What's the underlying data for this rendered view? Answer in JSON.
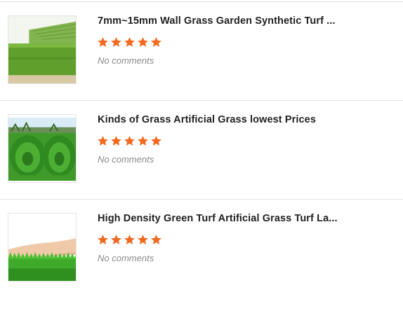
{
  "products": [
    {
      "title": "7mm~15mm Wall Grass Garden Synthetic Turf ...",
      "rating": 5,
      "comments": "No comments",
      "image": "green-wall-grass-thumbnail"
    },
    {
      "title": "Kinds of Grass Artificial Grass lowest Prices",
      "rating": 5,
      "comments": "No comments",
      "image": "rolled-artificial-grass-thumbnail"
    },
    {
      "title": "High Density Green Turf Artificial Grass Turf La...",
      "rating": 5,
      "comments": "No comments",
      "image": "hand-on-grass-thumbnail"
    }
  ],
  "colors": {
    "star": "#f26a22",
    "title": "#222222",
    "comments": "#8a8a8a",
    "separator": "#e3e3e3"
  }
}
